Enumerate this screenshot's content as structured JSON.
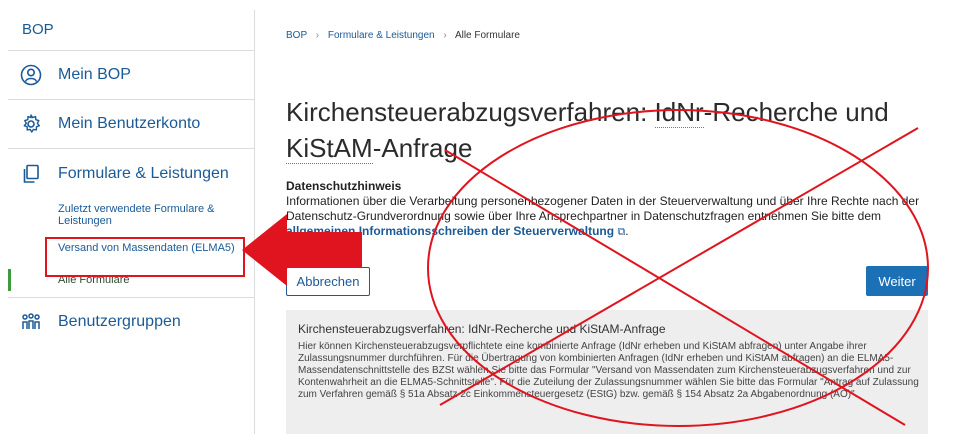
{
  "sidebar": {
    "title": "BOP",
    "items": [
      {
        "label": "Mein BOP",
        "icon": "user-circle-icon"
      },
      {
        "label": "Mein Benutzerkonto",
        "icon": "gear-icon"
      }
    ],
    "group": {
      "label": "Formulare & Leistungen",
      "icon": "documents-icon",
      "subitems": [
        {
          "label": "Zuletzt verwendete Formulare & Leistungen"
        },
        {
          "label": "Versand von Massendaten (ELMA5)"
        },
        {
          "label": "Alle Formulare"
        }
      ]
    },
    "last_item": {
      "label": "Benutzergruppen",
      "icon": "user-group-icon"
    }
  },
  "breadcrumb": [
    "BOP",
    "Formulare & Leistungen",
    "Alle Formulare"
  ],
  "page": {
    "title_part1": "Kirchensteuerabzugsverfahren: ",
    "title_abbr1": "IdNr",
    "title_part2": "-Recherche und ",
    "title_abbr2": "KiStAM",
    "title_part3": "-Anfrage",
    "privacy_heading": "Datenschutzhinweis",
    "privacy_text": "Informationen über die Verarbeitung personenbezogener Daten in der Steuerverwaltung und über Ihre Rechte nach der Datenschutz-Grundverordnung sowie über Ihre Ansprechpartner in Datenschutzfragen entnehmen Sie bitte dem ",
    "privacy_link": "allgemeinen Informationsschreiben der Steuerverwaltung",
    "cancel_label": "Abbrechen",
    "next_label": "Weiter"
  },
  "info": {
    "title": "Kirchensteuerabzugsverfahren: IdNr-Recherche und KiStAM-Anfrage",
    "description": "Hier können Kirchensteuerabzugsverpflichtete eine kombinierte Anfrage (IdNr erheben und KiStAM abfragen) unter Angabe ihrer Zulassungsnummer durchführen. Für die Übertragung von kombinierten Anfragen (IdNr erheben und KiStAM abfragen) an die ELMA5-Massendatenschnittstelle des BZSt wählen Sie bitte das Formular \"Versand von Massendaten zum Kirchensteuerabzugsverfahren und zur Kontenwahrheit an die ELMA5-Schnittstelle\". Für die Zuteilung der Zulassungsnummer wählen Sie bitte das Formular \"Antrag auf Zulassung zum Verfahren gemäß § 51a Absatz 2c Einkommensteuergesetz (EStG) bzw. gemäß § 154 Absatz 2a Abgabenordnung (AO)\"."
  },
  "annotations": {
    "color": "#e0141e"
  }
}
